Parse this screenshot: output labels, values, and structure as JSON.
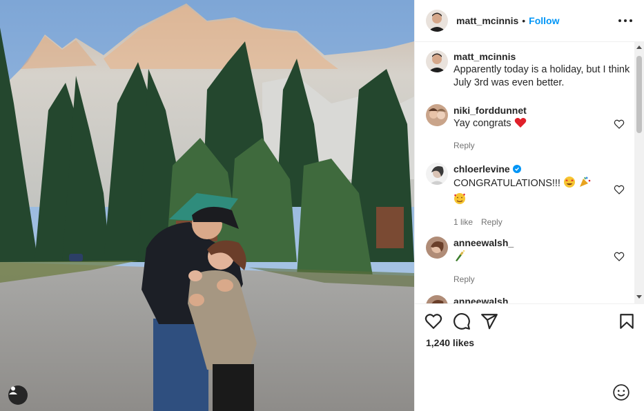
{
  "post": {
    "author": "matt_mcinnis",
    "separator": "•",
    "follow_label": "Follow",
    "caption": "Apparently today is a holiday, but I think July 3rd was even better.",
    "likes": "1,240 likes"
  },
  "comments": [
    {
      "user": "niki_forddunnet",
      "text": "Yay congrats",
      "emoji": "red-heart",
      "reply_label": "Reply"
    },
    {
      "user": "chloerlevine",
      "verified": true,
      "text": "CONGRATULATIONS!!!",
      "emoji": "heart-eyes party-popper smiling-hearts",
      "likes_label": "1 like",
      "reply_label": "Reply"
    },
    {
      "user": "anneewalsh_",
      "text": "",
      "emoji": "champagne-bottle",
      "reply_label": "Reply"
    },
    {
      "user": "anneewalsh_"
    }
  ],
  "icons": [
    "more-icon",
    "heart-icon",
    "comment-icon",
    "share-icon",
    "bookmark-icon",
    "emoji-icon",
    "user-tag-icon",
    "verified-icon"
  ],
  "colors": {
    "accent": "#0095f6",
    "text": "#262626",
    "secondary": "#737373",
    "heart_emoji": "#e0202a",
    "divider": "#efefef"
  }
}
